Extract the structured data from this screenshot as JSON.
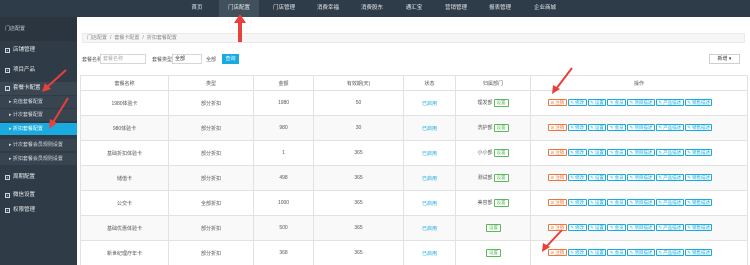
{
  "topnav": {
    "items": [
      "首页",
      "门店配置",
      "门店管理",
      "消费幸福",
      "消费股东",
      "通汇宝",
      "营销管理",
      "报表管理",
      "企业商城"
    ],
    "active_index": 1
  },
  "sidebar": {
    "header": "门店配置",
    "items": [
      {
        "label": "店铺管理",
        "sign": "+"
      },
      {
        "label": "项目产品",
        "sign": "+"
      },
      {
        "label": "套餐卡配置",
        "sign": "-"
      },
      {
        "label": "周期配置",
        "sign": "+"
      },
      {
        "label": "微信设置",
        "sign": "+"
      },
      {
        "label": "权限管理",
        "sign": "+"
      }
    ],
    "subitems": [
      {
        "label": "充值套餐配置"
      },
      {
        "label": "计次套餐配置"
      },
      {
        "label": "折扣套餐配置"
      },
      {
        "label": "计次套餐会员规则设置"
      },
      {
        "label": "折扣套餐会员规则设置"
      }
    ],
    "active_sub_index": 2
  },
  "breadcrumb": [
    "门店配置",
    "/",
    "套餐卡配置",
    "/",
    "折扣套餐配置"
  ],
  "filters": {
    "name_label": "套餐名称",
    "name_placeholder": "套餐名称",
    "type_label": "套餐类型",
    "type_value": "全部",
    "type_right": "全部",
    "query_label": "查询",
    "add_label": "新增 ▾"
  },
  "table": {
    "headers": [
      "套餐名称",
      "类型",
      "金额",
      "有效期(天)",
      "状态",
      "归属部门",
      "操作"
    ],
    "rows": [
      {
        "name": "1980体验卡",
        "type": "部分折扣",
        "amount": "1980",
        "days": "50",
        "status": "已启用",
        "dept": "理发部",
        "set": "设置"
      },
      {
        "name": "980体验卡",
        "type": "部分折扣",
        "amount": "980",
        "days": "30",
        "status": "已启用",
        "dept": "洗护部",
        "set": "设置"
      },
      {
        "name": "基础折扣体验卡",
        "type": "部分折扣",
        "amount": "1",
        "days": "365",
        "status": "已启用",
        "dept": "小小部",
        "set": "设置"
      },
      {
        "name": "储值卡",
        "type": "部分折扣",
        "amount": "498",
        "days": "365",
        "status": "已启用",
        "dept": "测试部",
        "set": "设置"
      },
      {
        "name": "公交卡",
        "type": "全部折扣",
        "amount": "1000",
        "days": "365",
        "status": "已启用",
        "dept": "美容部",
        "set": "设置"
      },
      {
        "name": "基础优惠体验卡",
        "type": "部分折扣",
        "amount": "500",
        "days": "365",
        "status": "已启用",
        "dept": "",
        "set": "设置"
      },
      {
        "name": "新世纪理疗年卡",
        "type": "部分折扣",
        "amount": "368",
        "days": "365",
        "status": "已启用",
        "dept": "",
        "set": "设置"
      }
    ],
    "ops": {
      "delete": "注销",
      "edit": "修改",
      "settings": "设置",
      "members": "会员",
      "projects": "项目描述",
      "products": "产品描述",
      "sales": "销售描述"
    }
  },
  "colors": {
    "accent": "#19aadf",
    "nav_bg": "#2e3b48",
    "sidebar_bg": "#2f3b46",
    "danger": "#e8793c",
    "success": "#5cb85c",
    "annotation_arrow": "#e8403a"
  }
}
